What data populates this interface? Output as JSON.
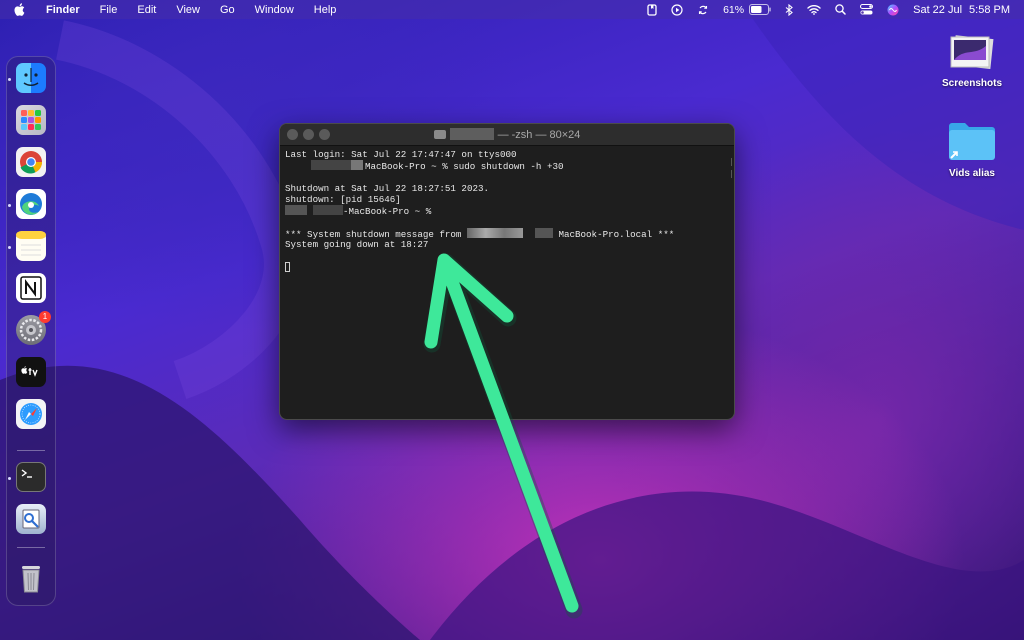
{
  "menubar": {
    "app_name": "Finder",
    "menus": [
      "File",
      "Edit",
      "View",
      "Go",
      "Window",
      "Help"
    ],
    "battery_percent": "61%",
    "date": "Sat 22 Jul",
    "time": "5:58 PM"
  },
  "dock": {
    "items": [
      {
        "name": "Finder",
        "icon": "finder-icon",
        "running": true,
        "color": "#1e90ff"
      },
      {
        "name": "Launchpad",
        "icon": "launchpad-icon",
        "running": false
      },
      {
        "name": "Google Chrome",
        "icon": "chrome-icon",
        "running": false
      },
      {
        "name": "Microsoft Edge",
        "icon": "edge-icon",
        "running": true
      },
      {
        "name": "Notes",
        "icon": "notes-icon",
        "running": true
      },
      {
        "name": "Notion",
        "icon": "notion-icon",
        "running": false
      },
      {
        "name": "System Settings",
        "icon": "settings-icon",
        "running": false,
        "badge": "1"
      },
      {
        "name": "Apple TV",
        "icon": "appletv-icon",
        "running": false
      },
      {
        "name": "Safari",
        "icon": "safari-icon",
        "running": false
      },
      {
        "name": "Terminal",
        "icon": "terminal-icon",
        "running": true
      },
      {
        "name": "Preview",
        "icon": "preview-icon",
        "running": false
      },
      {
        "name": "Trash",
        "icon": "trash-icon",
        "running": false
      }
    ]
  },
  "desktop": {
    "icons": [
      {
        "label": "Screenshots",
        "icon": "screenshots-folder-icon"
      },
      {
        "label": "Vids alias",
        "icon": "folder-alias-icon"
      }
    ]
  },
  "terminal": {
    "title": "— -zsh — 80×24",
    "lines": {
      "l1": "Last login: Sat Jul 22 17:47:47 on ttys000",
      "l2": "MacBook-Pro ~ % sudo shutdown -h +30",
      "l4": "Shutdown at Sat Jul 22 18:27:51 2023.",
      "l5": "shutdown: [pid 15646]",
      "l6": "-MacBook-Pro ~ %",
      "l8a": "*** System shutdown message from",
      "l8b": "MacBook-Pro.local ***",
      "l9": "System going down at 18:27"
    }
  },
  "colors": {
    "arrow": "#3ee89a",
    "terminal_bg": "#1e1e1e"
  }
}
